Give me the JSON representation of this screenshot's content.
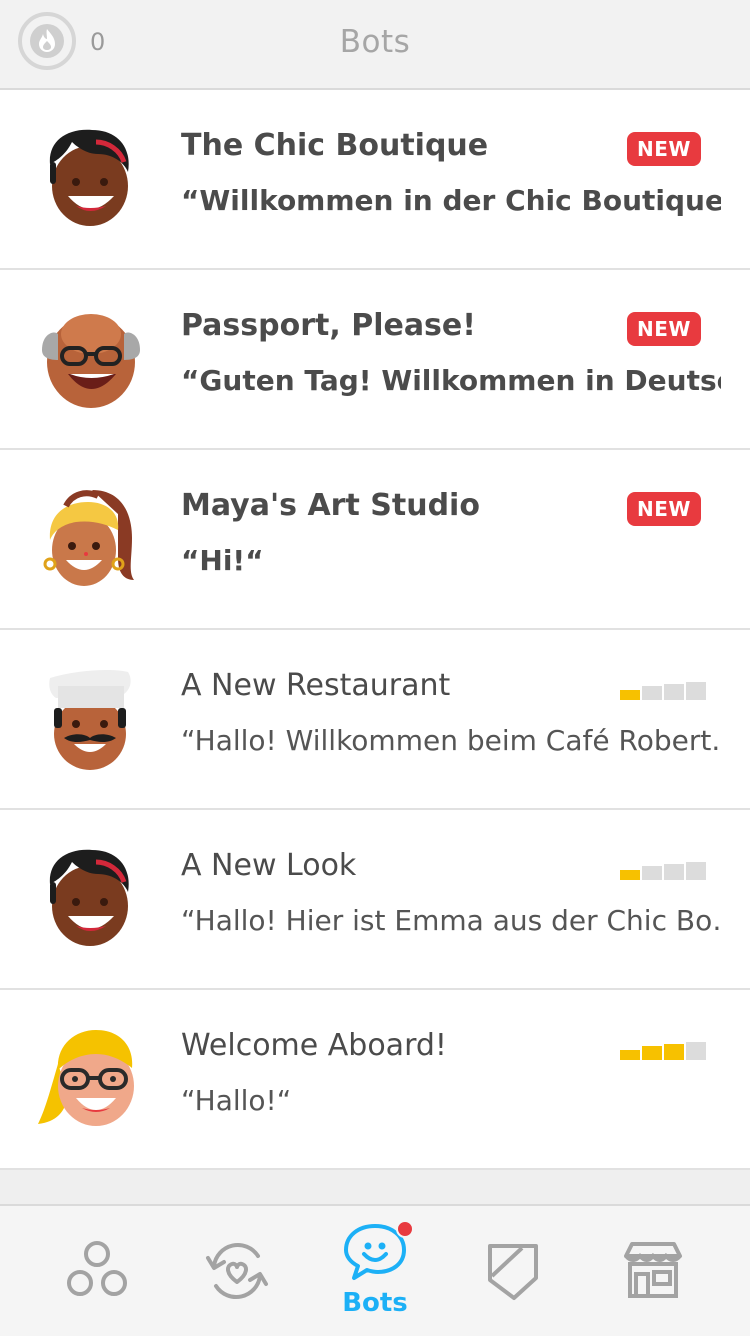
{
  "header": {
    "streak_count": "0",
    "title": "Bots"
  },
  "bots": [
    {
      "title": "The Chic Boutique",
      "subtitle": "“Willkommen in der Chic Boutique!“",
      "status": "new",
      "badge": "NEW",
      "avatar": "woman-black-hair"
    },
    {
      "title": "Passport, Please!",
      "subtitle": "“Guten Tag! Willkommen in Deutsch…",
      "status": "new",
      "badge": "NEW",
      "avatar": "bald-man-glasses"
    },
    {
      "title": "Maya's Art Studio",
      "subtitle": "“Hi!“",
      "status": "new",
      "badge": "NEW",
      "avatar": "woman-blonde-headband"
    },
    {
      "title": "A New Restaurant",
      "subtitle": "“Hallo! Willkommen beim Café Robert.“",
      "status": "level",
      "level": 1,
      "level_max": 4,
      "avatar": "chef-mustache"
    },
    {
      "title": "A New Look",
      "subtitle": "“Hallo! Hier ist Emma aus der Chic Bo…",
      "status": "level",
      "level": 1,
      "level_max": 4,
      "avatar": "woman-black-hair"
    },
    {
      "title": "Welcome Aboard!",
      "subtitle": "“Hallo!“",
      "status": "level",
      "level": 3,
      "level_max": 4,
      "avatar": "blonde-woman-glasses"
    }
  ],
  "nav": {
    "items": [
      {
        "name": "nav-learn",
        "icon": "circles-icon"
      },
      {
        "name": "nav-practice",
        "icon": "heart-refresh-icon"
      },
      {
        "name": "nav-bots",
        "icon": "bot-chat-icon",
        "label": "Bots",
        "active": true
      },
      {
        "name": "nav-labs",
        "icon": "shield-icon"
      },
      {
        "name": "nav-shop",
        "icon": "store-icon"
      }
    ]
  },
  "colors": {
    "accent": "#1cb0f6",
    "badge": "#e83a3f",
    "level_fill": "#f7c100",
    "level_empty": "#dcdcdc"
  }
}
